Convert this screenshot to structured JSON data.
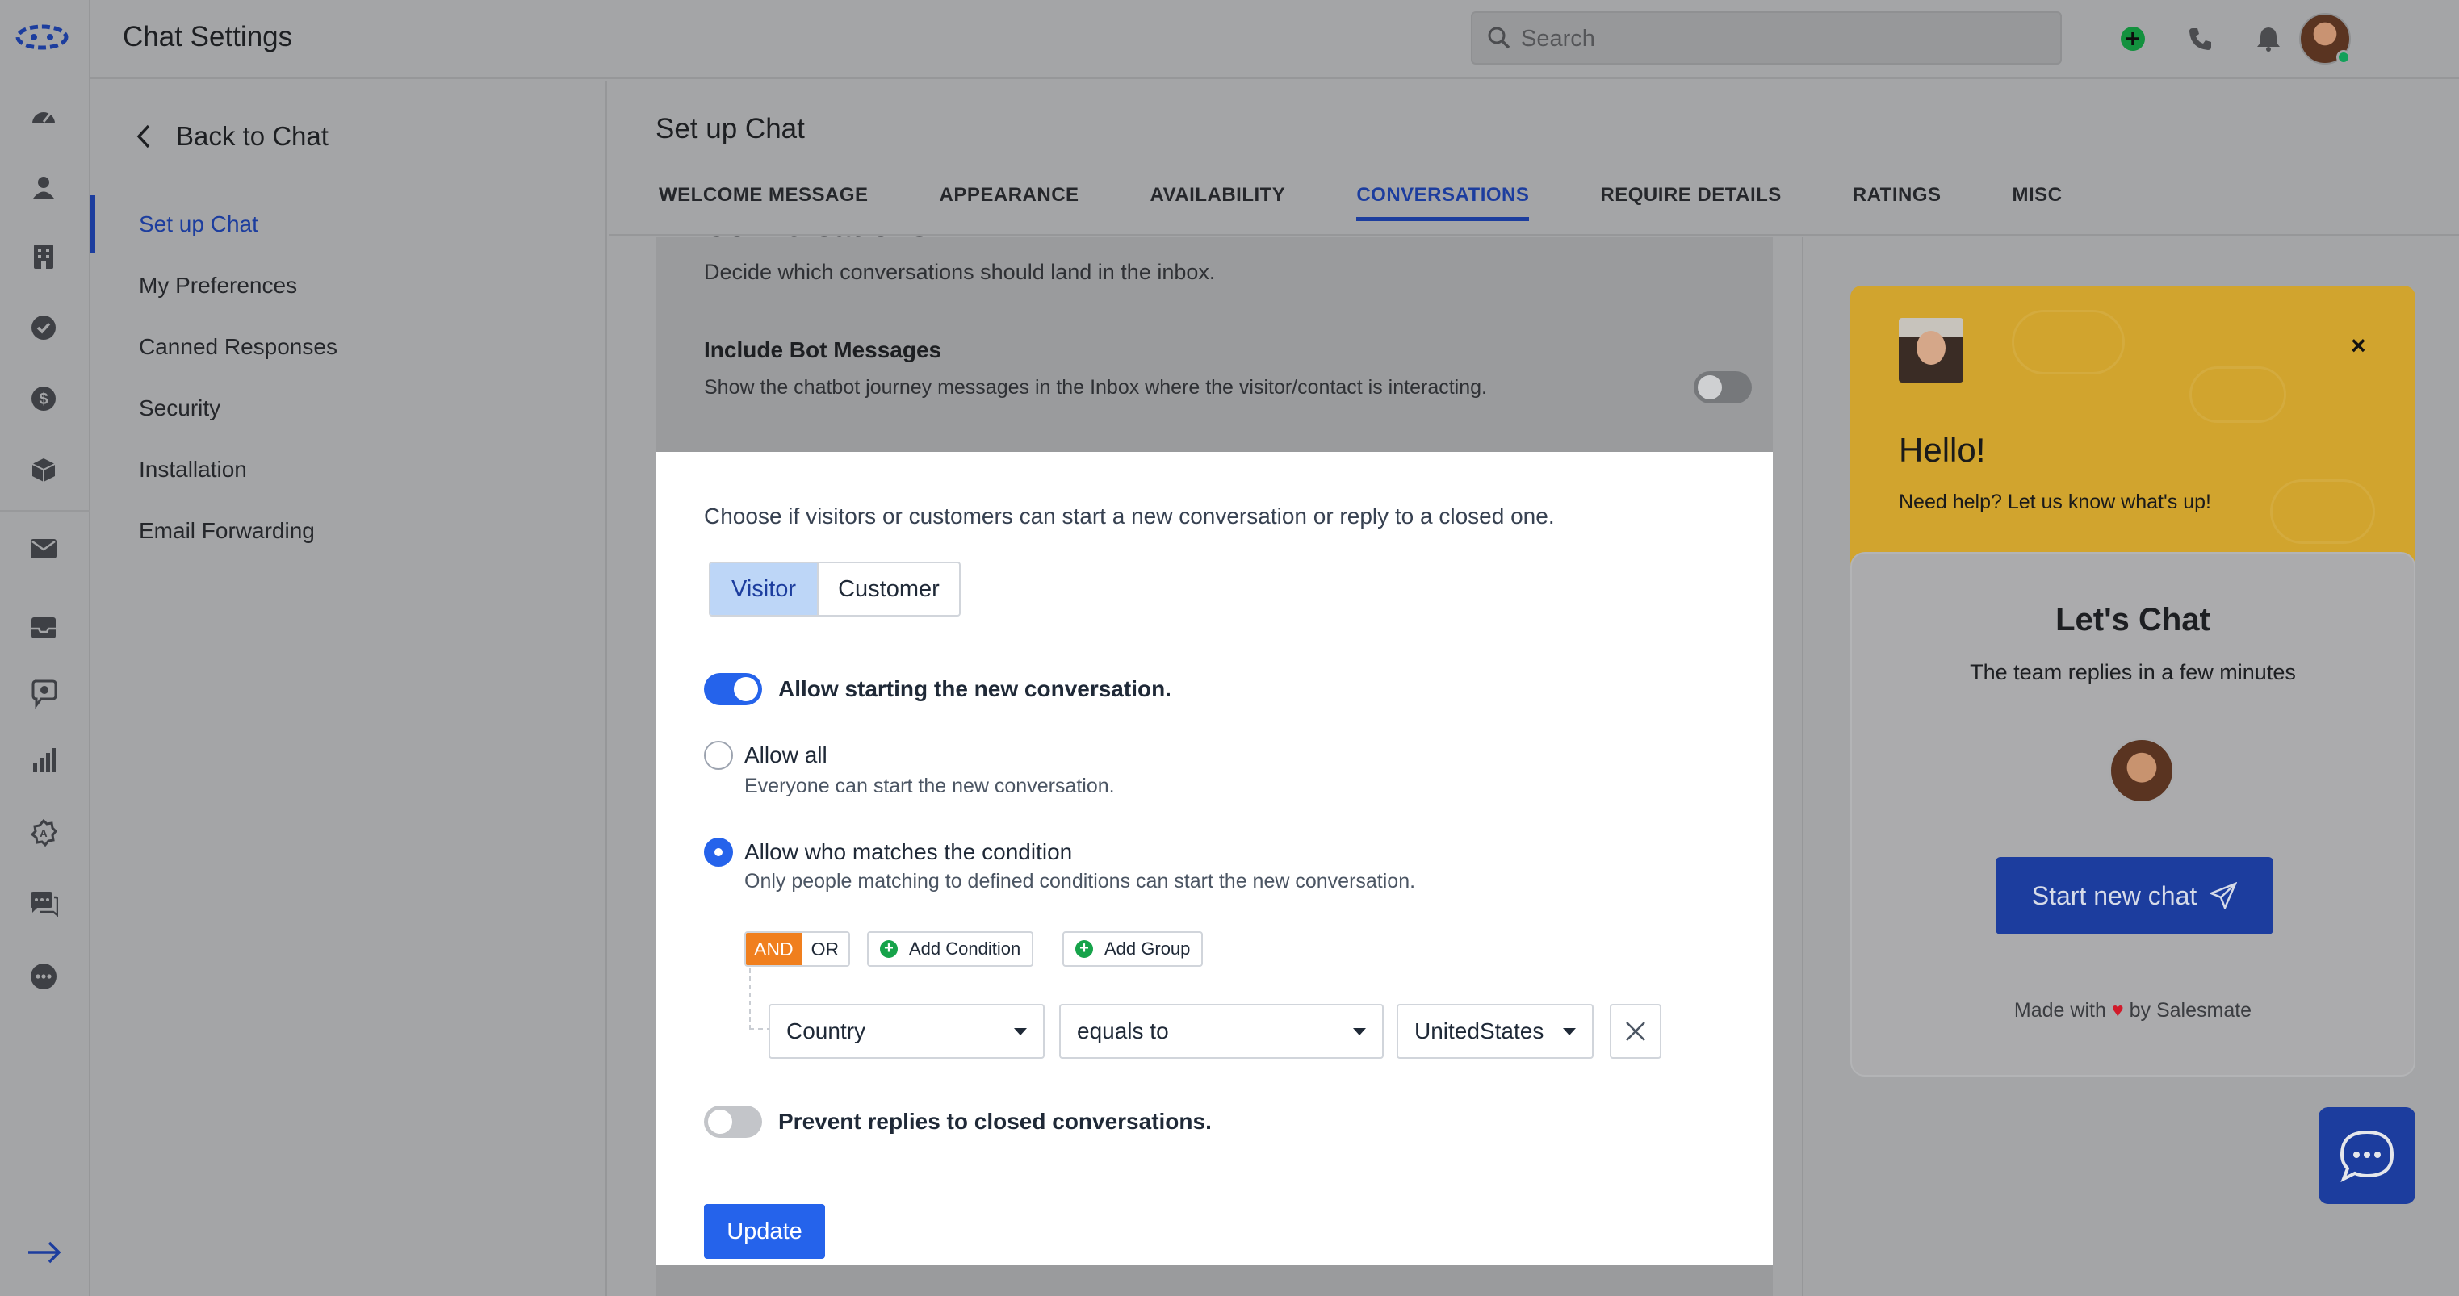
{
  "topbar": {
    "app_title": "Chat Settings",
    "search_placeholder": "Search",
    "icons": [
      "add-icon",
      "phone-icon",
      "bell-icon",
      "help-icon"
    ]
  },
  "rail": {
    "icons": [
      "dashboard-icon",
      "contacts-icon",
      "companies-icon",
      "tasks-icon",
      "deals-icon",
      "products-icon",
      "email-icon",
      "inbox-icon",
      "chat-bot-icon",
      "reports-icon",
      "automation-icon",
      "chats-icon",
      "more-icon",
      "expand-icon"
    ]
  },
  "sidebar": {
    "back_label": "Back to Chat",
    "items": [
      {
        "label": "Set up Chat",
        "active": true
      },
      {
        "label": "My Preferences",
        "active": false
      },
      {
        "label": "Canned Responses",
        "active": false
      },
      {
        "label": "Security",
        "active": false
      },
      {
        "label": "Installation",
        "active": false
      },
      {
        "label": "Email Forwarding",
        "active": false
      }
    ]
  },
  "main": {
    "title": "Set up Chat",
    "tabs": [
      {
        "label": "WELCOME MESSAGE",
        "active": false
      },
      {
        "label": "APPEARANCE",
        "active": false
      },
      {
        "label": "AVAILABILITY",
        "active": false
      },
      {
        "label": "CONVERSATIONS",
        "active": true
      },
      {
        "label": "REQUIRE DETAILS",
        "active": false
      },
      {
        "label": "RATINGS",
        "active": false
      },
      {
        "label": "MISC",
        "active": false
      }
    ],
    "section_heading": "Conversations",
    "section_desc": "Decide which conversations should land in the inbox.",
    "bot_messages": {
      "title": "Include Bot Messages",
      "desc": "Show the chatbot journey messages in the Inbox where the visitor/contact is interacting.",
      "enabled": false
    }
  },
  "panel": {
    "desc": "Choose if visitors or customers can start a new conversation or reply to a closed one.",
    "segments": [
      {
        "label": "Visitor",
        "selected": true
      },
      {
        "label": "Customer",
        "selected": false
      }
    ],
    "allow_start": {
      "label": "Allow starting the new conversation.",
      "enabled": true
    },
    "options": [
      {
        "label": "Allow all",
        "sub": "Everyone can start the new conversation.",
        "checked": false
      },
      {
        "label": "Allow who matches the condition",
        "sub": "Only people matching to defined conditions can start the new conversation.",
        "checked": true
      }
    ],
    "logic": {
      "and": "AND",
      "or": "OR",
      "selected": "AND"
    },
    "add_condition": "Add Condition",
    "add_group": "Add Group",
    "condition": {
      "field": "Country",
      "operator": "equals to",
      "value": "UnitedStates"
    },
    "prevent_replies": {
      "label": "Prevent replies to closed conversations.",
      "enabled": false
    },
    "update_label": "Update"
  },
  "widget": {
    "hello": "Hello!",
    "help": "Need help? Let us know what's up!",
    "close": "×",
    "card_title": "Let's Chat",
    "card_sub": "The team replies in a few minutes",
    "start_label": "Start new chat",
    "made_prefix": "Made with",
    "heart": "♥",
    "made_suffix": "by Salesmate",
    "colors": {
      "header": "#d1a42e",
      "button": "#1c3d9e"
    }
  }
}
